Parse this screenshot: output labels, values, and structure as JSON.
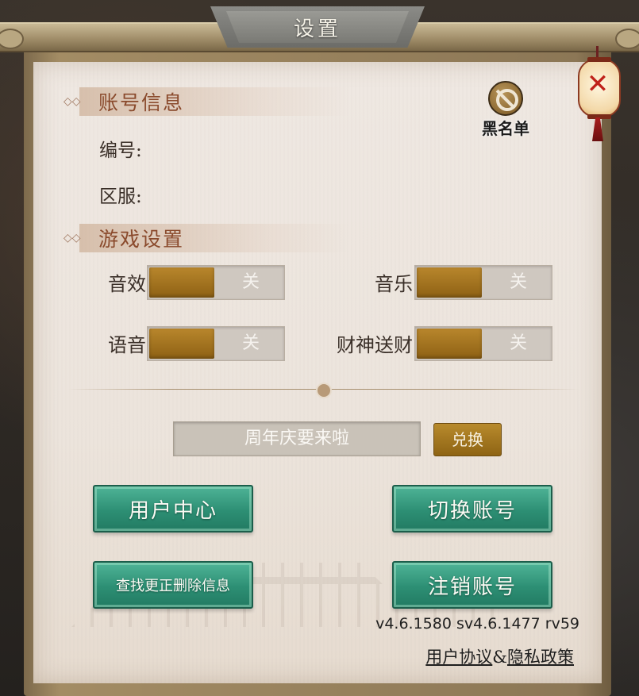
{
  "title": "设置",
  "blacklist": {
    "label": "黑名单",
    "icon": "ban-icon"
  },
  "close": {
    "icon": "close-icon"
  },
  "account": {
    "header": "账号信息",
    "id_label": "编号:",
    "server_label": "区服:"
  },
  "game_settings": {
    "header": "游戏设置",
    "toggles": [
      {
        "label": "音效",
        "state": "关"
      },
      {
        "label": "音乐",
        "state": "关"
      },
      {
        "label": "语音",
        "state": "关"
      },
      {
        "label": "财神送财",
        "state": "关"
      }
    ]
  },
  "redeem": {
    "input_value": "周年庆要来啦",
    "button_label": "兑换"
  },
  "buttons": {
    "user_center": "用户中心",
    "switch_account": "切换账号",
    "find_delete_info": "查找更正删除信息",
    "cancel_account": "注销账号"
  },
  "version": "v4.6.1580 sv4.6.1477 rv59",
  "policy": {
    "user_agreement": "用户协议",
    "amp": "&",
    "privacy_policy": "隐私政策"
  },
  "colors": {
    "accent_gold": "#a8791f",
    "jade_button": "#2d8f74",
    "section_header_text": "#8a4a2c",
    "paper": "#ece4dc"
  }
}
